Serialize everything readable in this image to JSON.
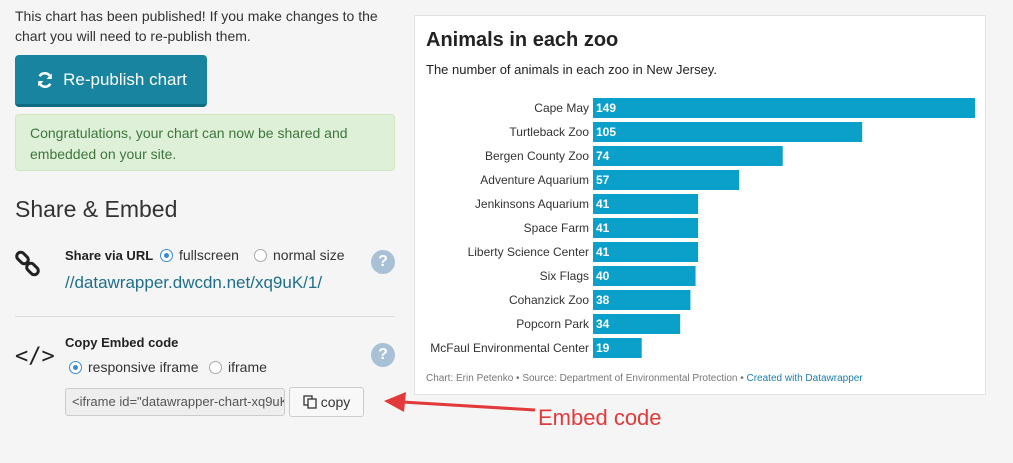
{
  "publish": {
    "message": "This chart has been published! If you make changes to the chart you will need to re-publish them.",
    "republish_label": "Re-publish chart",
    "success_text": "Congratulations, your chart can now be shared and embedded on your site."
  },
  "share_embed": {
    "title": "Share & Embed",
    "share_url_label": "Share via URL",
    "url_options": [
      {
        "label": "fullscreen",
        "selected": true
      },
      {
        "label": "normal size",
        "selected": false
      }
    ],
    "url": "//datawrapper.dwcdn.net/xq9uK/1/",
    "embed_label": "Copy Embed code",
    "embed_options": [
      {
        "label": "responsive iframe",
        "selected": true
      },
      {
        "label": "iframe",
        "selected": false
      }
    ],
    "embed_code": "<iframe id=\"datawrapper-chart-xq9uK\"",
    "copy_label": "copy",
    "help_symbol": "?"
  },
  "annotation": {
    "text": "Embed code",
    "color": "#e23a3a"
  },
  "chart_data": {
    "type": "bar",
    "title": "Animals in each zoo",
    "subtitle": "The number of animals in each zoo in New Jersey.",
    "categories": [
      "Cape May",
      "Turtleback Zoo",
      "Bergen County Zoo",
      "Adventure Aquarium",
      "Jenkinsons Aquarium",
      "Space Farm",
      "Liberty Science Center",
      "Six Flags",
      "Cohanzick Zoo",
      "Popcorn Park",
      "McFaul Environmental Center"
    ],
    "values": [
      149,
      105,
      74,
      57,
      41,
      41,
      41,
      40,
      38,
      34,
      19
    ],
    "bar_color": "#0ba0c9",
    "orientation": "horizontal",
    "footer": {
      "chart_by": "Chart: Erin Petenko",
      "source": "Source: Department of Environmental Protection",
      "credit": "Created with Datawrapper"
    }
  }
}
